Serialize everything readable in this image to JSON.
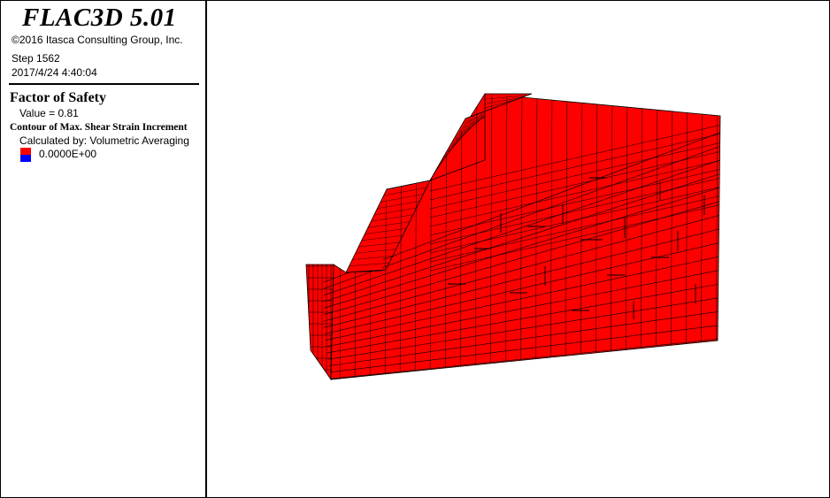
{
  "legend": {
    "app_title": "FLAC3D 5.01",
    "copyright": "©2016 Itasca Consulting Group, Inc.",
    "step": "Step 1562",
    "timestamp": "2017/4/24 4:40:04",
    "fos_title": "Factor of Safety",
    "fos_value": "Value = 0.81",
    "contour_title": "Contour of Max. Shear Strain Increment",
    "calculated_by": "Calculated by: Volumetric Averaging",
    "scale_value": "0.0000E+00",
    "swatch_colors": {
      "top": "#ff0000",
      "bottom": "#0000ff"
    }
  },
  "model": {
    "fill_color": "#ff0000",
    "edge_color": "#000000"
  }
}
